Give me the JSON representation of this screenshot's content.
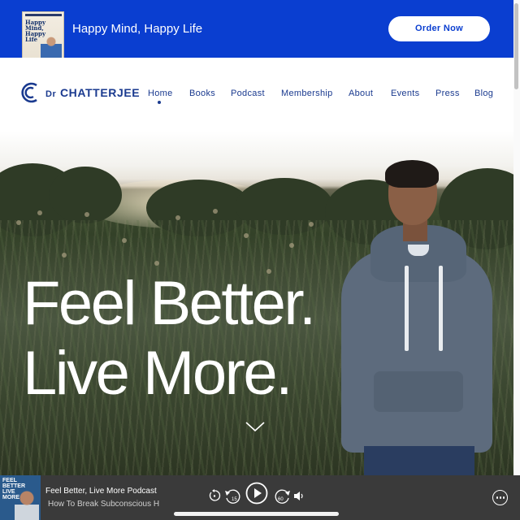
{
  "promo": {
    "book_title": "Happy Mind, Happy Life",
    "cover_author": "DR RANGAN CHATTERJEE",
    "cover_title": [
      "Happy",
      "Mind,",
      "Happy",
      "Life"
    ],
    "order_label": "Order Now"
  },
  "brand": {
    "logo_prefix": "Dr",
    "logo_name": "CHATTERJEE"
  },
  "nav": {
    "items": [
      "Home",
      "Books",
      "Podcast",
      "Membership",
      "About",
      "Events",
      "Press",
      "Blog"
    ],
    "active": "Home"
  },
  "hero": {
    "line1": "Feel Better.",
    "line2": "Live More."
  },
  "player": {
    "art_text": [
      "FEEL",
      "BETTER",
      "LIVE",
      "MORE"
    ],
    "title": "Feel Better, Live More Podcast",
    "episode": "How To Break Subconscious H",
    "rewind_label": "15",
    "forward_label": "60"
  },
  "colors": {
    "brand_blue": "#0a3ed0",
    "nav_text": "#1a3a8f",
    "player_bg": "#3a3a3a"
  }
}
